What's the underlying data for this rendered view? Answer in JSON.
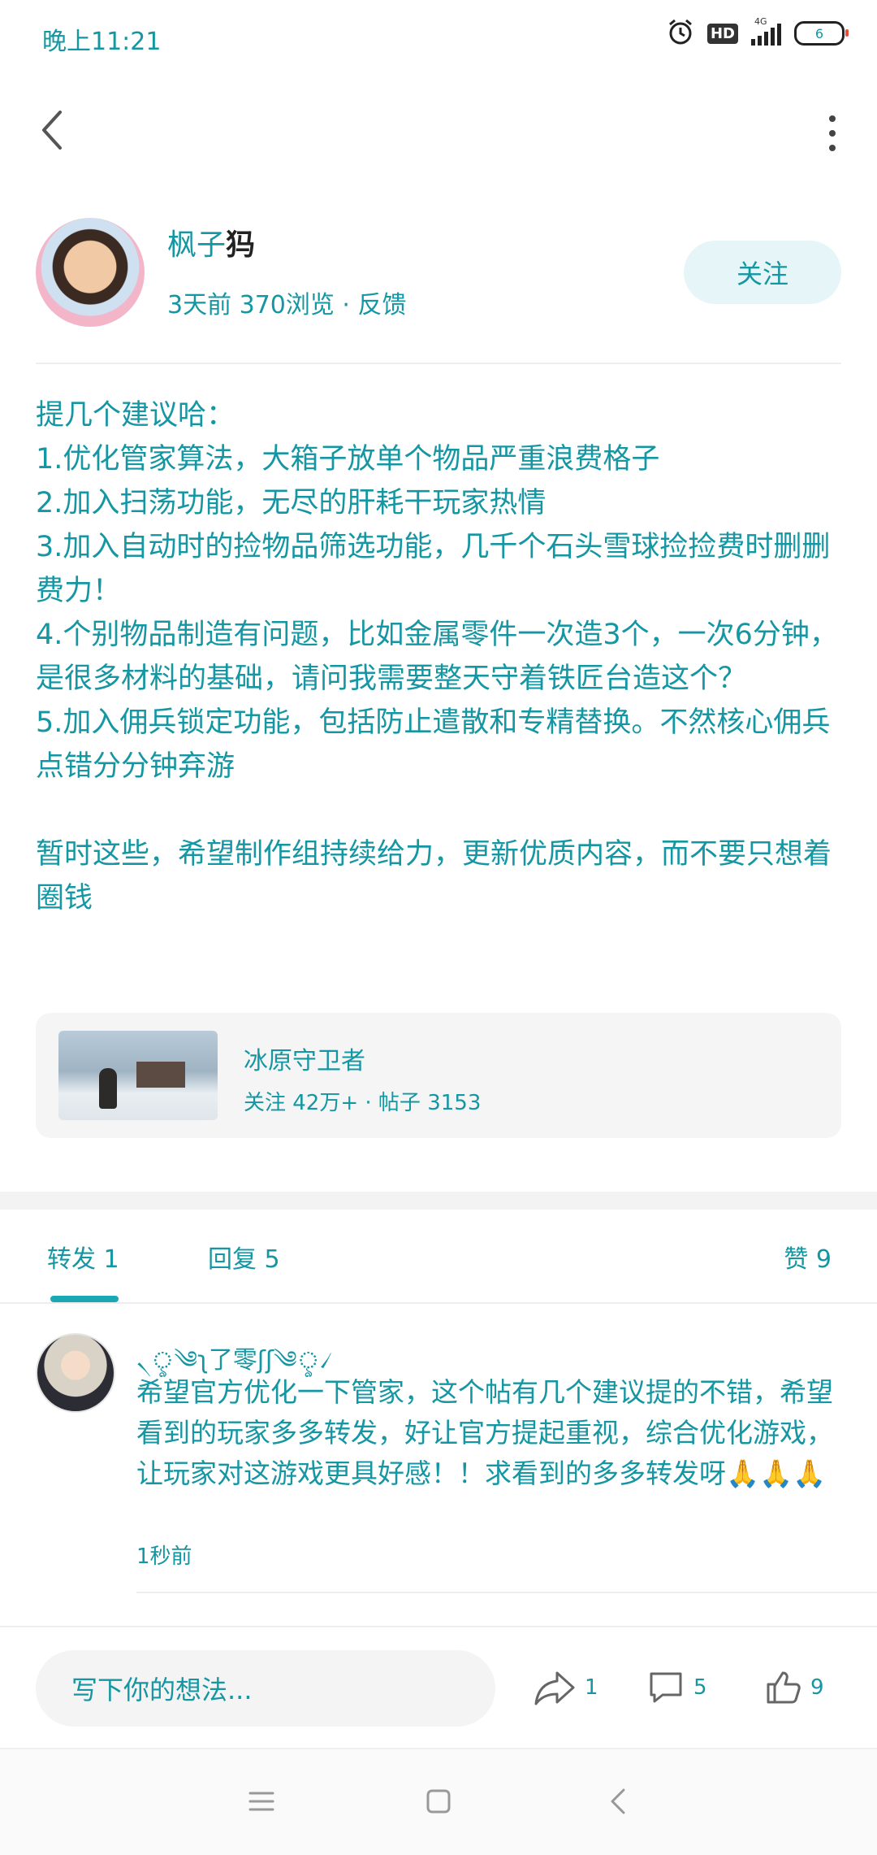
{
  "status_bar": {
    "time": "晚上11:21",
    "network": "4G",
    "hd_label": "HD",
    "battery": "6"
  },
  "author": {
    "name": "枫子",
    "name_suffix": "犸",
    "meta": "3天前  370浏览 · 反馈",
    "follow_label": "关注"
  },
  "post": {
    "lines": [
      "提几个建议哈：",
      "1.优化管家算法，大箱子放单个物品严重浪费格子",
      "2.加入扫荡功能，无尽的肝耗干玩家热情",
      "3.加入自动时的捡物品筛选功能，几千个石头雪球捡捡费时删删费力！",
      "4.个别物品制造有问题，比如金属零件一次造3个，一次6分钟，是很多材料的基础，请问我需要整天守着铁匠台造这个？",
      "5.加入佣兵锁定功能，包括防止遣散和专精替换。不然核心佣兵点错分分钟弃游",
      "",
      "暂时这些，希望制作组持续给力，更新优质内容，而不要只想着圈钱"
    ]
  },
  "game_card": {
    "title": "冰原守卫者",
    "meta": "关注 42万+ · 帖子 3153"
  },
  "tabs": {
    "repost": "转发 1",
    "reply": "回复 5",
    "like": "赞 9"
  },
  "comment": {
    "user": "৲ৢ༄ʅ了零ʃʃ༄ৢ৴",
    "text": "希望官方优化一下管家，这个帖有几个建议提的不错，希望看到的玩家多多转发，好让官方提起重视，综合优化游戏，让玩家对这游戏更具好感！！求看到的多多转发呀🙏🙏🙏",
    "time": "1秒前"
  },
  "bottom_bar": {
    "input_placeholder": "写下你的想法...",
    "share_count": "1",
    "reply_count": "5",
    "like_count": "9"
  },
  "colors": {
    "accent": "#1596a3",
    "follow_bg": "#e6f6f8",
    "card_bg": "#f5f5f5"
  }
}
